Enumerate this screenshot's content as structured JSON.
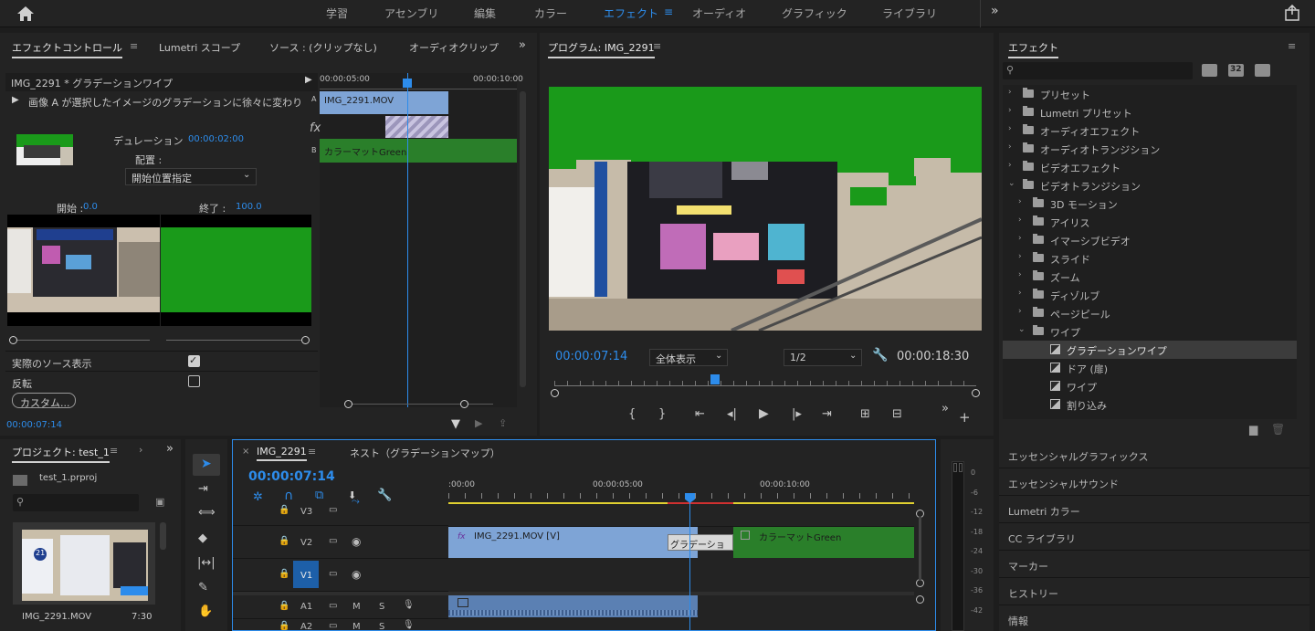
{
  "topbar": {
    "tabs": [
      "学習",
      "アセンブリ",
      "編集",
      "カラー",
      "エフェクト",
      "オーディオ",
      "グラフィック",
      "ライブラリ"
    ],
    "active_tab": "エフェクト",
    "more": "»"
  },
  "effect_controls": {
    "tabs": [
      "エフェクトコントロール",
      "Lumetri スコープ",
      "ソース : (クリップなし)",
      "オーディオクリップ"
    ],
    "clip_header": "IMG_2291 * グラデーションワイプ",
    "description": "画像 A が選択したイメージのグラデーションに徐々に変わり",
    "duration_label": "デュレーション",
    "duration_value": "00:00:02:00",
    "alignment_label": "配置 :",
    "alignment_value": "開始位置指定",
    "start_label": "開始 :",
    "start_value": "0.0",
    "end_label": "終了 :",
    "end_value": "100.0",
    "show_actual_sources": "実際のソース表示",
    "reverse": "反転",
    "custom_button": "カスタム...",
    "timecode": "00:00:07:14",
    "mini_timeline": {
      "ruler_left": "00:00:05:00",
      "ruler_right": "00:00:10:00",
      "clip_a": "IMG_2291.MOV",
      "track_a": "A",
      "track_b": "B",
      "clip_b": "カラーマットGreen",
      "fx": "fx"
    }
  },
  "program": {
    "title": "プログラム: IMG_2291",
    "timecode": "00:00:07:14",
    "zoom": "全体表示",
    "resolution": "1/2",
    "duration": "00:00:18:30"
  },
  "effects_panel": {
    "title": "エフェクト",
    "search_placeholder": "",
    "badges": [
      "32"
    ],
    "tree": [
      {
        "label": "プリセット",
        "level": 0,
        "type": "folder",
        "expanded": false
      },
      {
        "label": "Lumetri プリセット",
        "level": 0,
        "type": "folder",
        "expanded": false
      },
      {
        "label": "オーディオエフェクト",
        "level": 0,
        "type": "folder",
        "expanded": false
      },
      {
        "label": "オーディオトランジション",
        "level": 0,
        "type": "folder",
        "expanded": false
      },
      {
        "label": "ビデオエフェクト",
        "level": 0,
        "type": "folder",
        "expanded": false
      },
      {
        "label": "ビデオトランジション",
        "level": 0,
        "type": "folder",
        "expanded": true
      },
      {
        "label": "3D モーション",
        "level": 1,
        "type": "folder",
        "expanded": false
      },
      {
        "label": "アイリス",
        "level": 1,
        "type": "folder",
        "expanded": false
      },
      {
        "label": "イマーシブビデオ",
        "level": 1,
        "type": "folder",
        "expanded": false
      },
      {
        "label": "スライド",
        "level": 1,
        "type": "folder",
        "expanded": false
      },
      {
        "label": "ズーム",
        "level": 1,
        "type": "folder",
        "expanded": false
      },
      {
        "label": "ディゾルブ",
        "level": 1,
        "type": "folder",
        "expanded": false
      },
      {
        "label": "ページピール",
        "level": 1,
        "type": "folder",
        "expanded": false
      },
      {
        "label": "ワイプ",
        "level": 1,
        "type": "folder",
        "expanded": true
      },
      {
        "label": "グラデーションワイプ",
        "level": 2,
        "type": "effect",
        "selected": true
      },
      {
        "label": "ドア (扉)",
        "level": 2,
        "type": "effect"
      },
      {
        "label": "ワイプ",
        "level": 2,
        "type": "effect"
      },
      {
        "label": "割り込み",
        "level": 2,
        "type": "effect"
      }
    ],
    "accordion": [
      "エッセンシャルグラフィックス",
      "エッセンシャルサウンド",
      "Lumetri カラー",
      "CC ライブラリ",
      "マーカー",
      "ヒストリー",
      "情報"
    ]
  },
  "project": {
    "title": "プロジェクト: test_1",
    "file": "test_1.prproj",
    "item_name": "IMG_2291.MOV",
    "item_duration": "7:30",
    "thumb_badge": "21"
  },
  "timeline": {
    "tab": "IMG_2291",
    "tab2": "ネスト（グラデーションマップ）",
    "timecode": "00:00:07:14",
    "ruler": [
      ":00:00",
      "00:00:05:00",
      "00:00:10:00"
    ],
    "tracks": [
      "V3",
      "V2",
      "V1",
      "A1",
      "A2"
    ],
    "track_toggles": [
      "M",
      "S"
    ],
    "clip_v": "IMG_2291.MOV [V]",
    "transition": "グラデーショ",
    "clip_matte": "カラーマットGreen",
    "fx": "fx"
  },
  "meters": [
    "0",
    "-6",
    "-12",
    "-18",
    "-24",
    "-30",
    "-36",
    "-42"
  ],
  "colors": {
    "accent": "#2d8ceb",
    "green": "#1a9a1a",
    "clip_blue": "#7ea4d6",
    "matte_green": "#2a7f2a"
  }
}
